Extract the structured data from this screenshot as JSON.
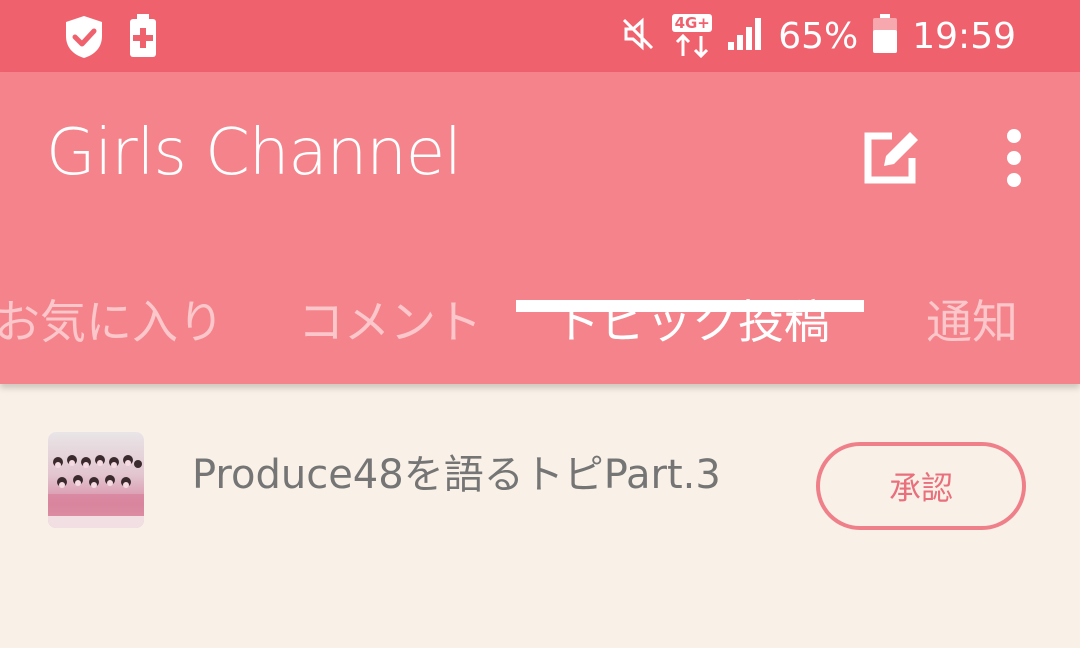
{
  "status_bar": {
    "icons_left": [
      "shield-check-icon",
      "battery-plus-icon"
    ],
    "icons_right": [
      "mute-icon",
      "4g-data-icon",
      "signal-icon",
      "battery-icon"
    ],
    "network": "4G+",
    "battery": "65%",
    "time": "19:59"
  },
  "app_bar": {
    "title": "Girls Channel",
    "actions": [
      "edit-icon",
      "more-vert-icon"
    ]
  },
  "tabs": [
    {
      "label": "お気に入り",
      "active": false
    },
    {
      "label": "コメント",
      "active": false
    },
    {
      "label": "トピック投稿",
      "active": true
    },
    {
      "label": "通知",
      "active": false
    }
  ],
  "topic": {
    "title": "Produce48を語るトピPart.3",
    "approve_label": "承認"
  },
  "colors": {
    "status_bar": "#f0616e",
    "app_bar": "#f5838b",
    "background": "#f9f1e7",
    "accent": "#ef7f89"
  }
}
